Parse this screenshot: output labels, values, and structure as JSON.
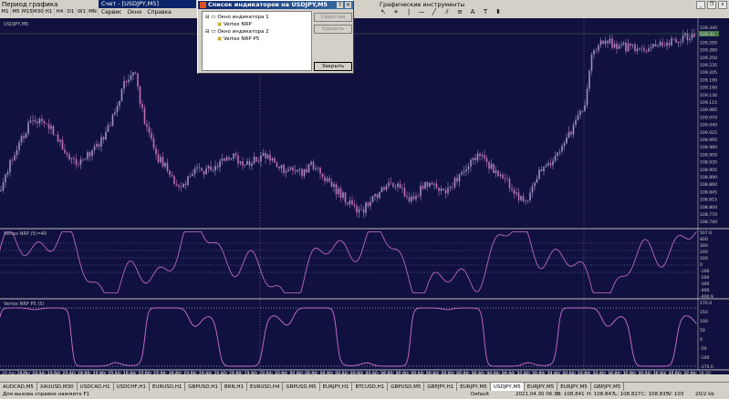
{
  "toolbar_left": {
    "title": "Период графика",
    "timeframes": [
      "M1",
      "M5",
      "M15",
      "M30",
      "H1",
      "H4",
      "D1",
      "W1",
      "MN"
    ]
  },
  "toolbar_mid": {
    "window_title": "Счет - [USDJPY,M5]",
    "menu": [
      "Сервис",
      "Окно",
      "Справка"
    ]
  },
  "toolbar_right": {
    "title": "Графические инструменты"
  },
  "chart": {
    "symbol_label": "USDJPY,M5",
    "price_label_current": "109.32",
    "indicator1_label": "Vertex NRP (5)=40",
    "indicator2_label": "Vertex NRP P5 (5)",
    "price_ticks": [
      "109.340",
      "109.325",
      "109.295",
      "109.280",
      "109.250",
      "109.235",
      "109.205",
      "109.190",
      "109.160",
      "109.130",
      "109.115",
      "109.085",
      "109.070",
      "109.040",
      "109.025",
      "108.995",
      "108.980",
      "108.950",
      "108.935",
      "108.905",
      "108.890",
      "108.860",
      "108.845",
      "108.815",
      "108.800",
      "108.770",
      "108.740"
    ],
    "ind1_ticks": [
      "507.6",
      "400",
      "300",
      "200",
      "100",
      "0",
      "-100",
      "-200",
      "-300",
      "-400",
      "-400.9"
    ],
    "ind2_ticks": [
      "176.0",
      "150",
      "100",
      "50",
      "0",
      "-50",
      "-100",
      "-170.0"
    ],
    "time_ticks": [
      "29 Apr 2021",
      "29 Apr 12:10",
      "29 Apr 12:50",
      "29 Apr 13:40",
      "29 Apr 14:20",
      "29 Apr 15:00",
      "29 Apr 15:40",
      "29 Apr 16:20",
      "29 Apr 17:00",
      "29 Apr 17:40",
      "29 Apr 18:20",
      "29 Apr 19:00",
      "29 Apr 19:40",
      "29 Apr 20:20",
      "29 Apr 21:00",
      "29 Apr 21:40",
      "29 Apr 22:20",
      "29 Apr 23:00",
      "30 Apr 00:20",
      "30 Apr 01:00",
      "30 Apr 01:40",
      "30 Apr 02:20",
      "30 Apr 03:00",
      "30 Apr 03:40",
      "30 Apr 04:20",
      "30 Apr 05:00",
      "30 Apr 05:40",
      "30 Apr 06:20",
      "30 Apr 07:00",
      "30 Apr 07:40",
      "30 Apr 08:20",
      "30 Apr 09:00",
      "30 Apr 09:40",
      "30 Apr 10:20",
      "30 Apr 11:00",
      "30 Apr 11:40",
      "30 Apr 12:20",
      "30 Apr 13:00",
      "30 Apr 13:40",
      "30 Apr 14:20",
      "30 Apr 15:00",
      "30 Apr 15:40",
      "30 Apr 16:20",
      "30 Apr 17:00",
      "30 Apr 17:40",
      "30 Apr 18:20"
    ]
  },
  "dialog": {
    "title": "Список индикаторов на USDJPY,M5",
    "tree": [
      "Окно индикатора 1",
      "Vertex NRP",
      "Окно индикатора 2",
      "Vertex NRP P5"
    ],
    "btn_props": "Свойства",
    "btn_delete": "Удалить",
    "btn_close": "Закрыть"
  },
  "tabs": [
    "AUDCAD,M5",
    "XAUUSD,M30",
    "USDCAD,H1",
    "USDCHF,H1",
    "EURUSD,H1",
    "GBPUSD,H1",
    "BRN,H1",
    "EURUSD,H4",
    "GBPUSD,M5",
    "EURJPY,H1",
    "BTCUSD,H1",
    "GBPUSD,M5",
    "GBPJPY,H1",
    "EURJPY,M5",
    "USDJPY,M5",
    "EURJPY,M5",
    "EURJPY,M5",
    "GBPJPY,M5"
  ],
  "active_tab": "USDJPY,M5",
  "status": {
    "help": "Для вызова справки нажмите F1",
    "profile": "Default",
    "datetime": "2021.04.30 06:30",
    "open": "O: 108.841",
    "high": "H: 108.847",
    "low": "L: 108.827",
    "close": "C: 108.835",
    "volume": "V: 103",
    "traffic": "20/2 kb"
  },
  "colors": {
    "chart_bg": "#11113f",
    "candle_up": "#9e8fc4",
    "candle_down": "#c070b0",
    "indicator_line": "#d070d0",
    "level_line": "#ffffff"
  }
}
